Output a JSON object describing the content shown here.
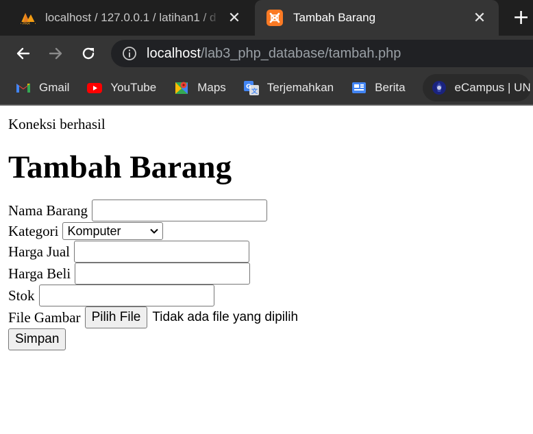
{
  "browser": {
    "tabs": [
      {
        "title": "localhost / 127.0.0.1 / latihan1 / d",
        "active": false,
        "icon": "phpmyadmin-icon"
      },
      {
        "title": "Tambah Barang",
        "active": true,
        "icon": "xampp-icon"
      }
    ],
    "close_glyph": "✕",
    "newtab_glyph": "+",
    "url": {
      "host": "localhost",
      "path": "/lab3_php_database/tambah.php"
    },
    "bookmarks": [
      {
        "label": "Gmail",
        "icon": "gmail-icon"
      },
      {
        "label": "YouTube",
        "icon": "youtube-icon"
      },
      {
        "label": "Maps",
        "icon": "maps-icon"
      },
      {
        "label": "Terjemahkan",
        "icon": "translate-icon"
      },
      {
        "label": "Berita",
        "icon": "news-icon"
      },
      {
        "label": "eCampus | UN",
        "icon": "ecampus-icon"
      }
    ]
  },
  "page": {
    "status": "Koneksi berhasil",
    "heading": "Tambah Barang",
    "form": {
      "nama_label": "Nama Barang",
      "nama_value": "",
      "kategori_label": "Kategori",
      "kategori_selected": "Komputer",
      "harga_jual_label": "Harga Jual",
      "harga_jual_value": "",
      "harga_beli_label": "Harga Beli",
      "harga_beli_value": "",
      "stok_label": "Stok",
      "stok_value": "",
      "gambar_label": "File Gambar",
      "file_button": "Pilih File",
      "file_status": "Tidak ada file yang dipilih",
      "submit": "Simpan"
    }
  },
  "colors": {
    "tabstrip_bg": "#1f1f1f",
    "toolbar_bg": "#353535",
    "omnibox_bg": "#202124",
    "xampp_orange": "#fb7a24"
  }
}
